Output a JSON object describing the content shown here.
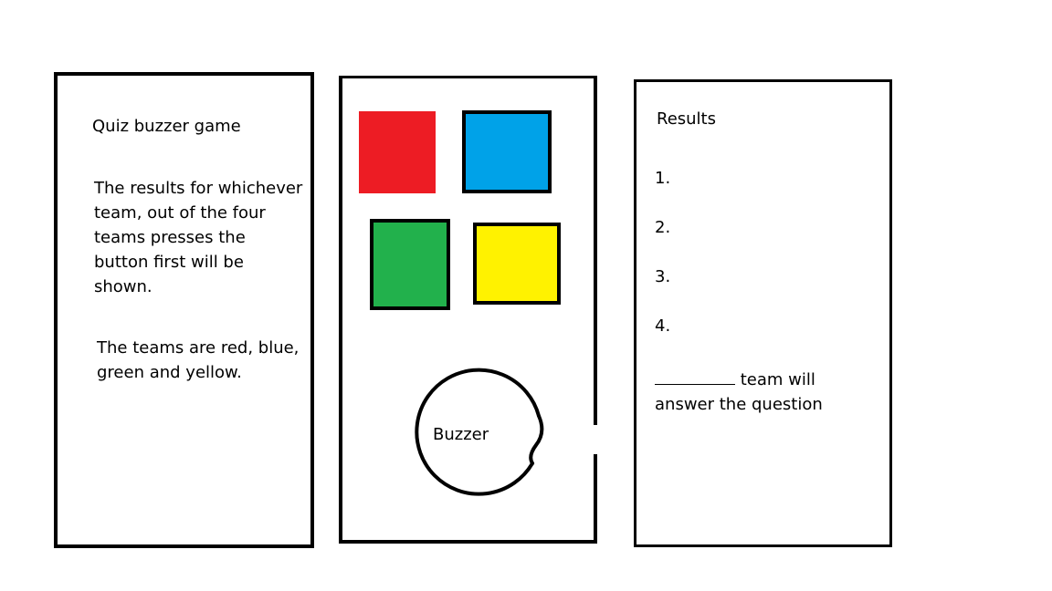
{
  "left_panel": {
    "title": "Quiz buzzer game",
    "description_1": "The results for whichever team, out of the four teams presses the button first will be shown.",
    "description_2": "The teams are red, blue, green and yellow."
  },
  "middle_panel": {
    "buttons": [
      {
        "name": "red",
        "color": "#ED1C24"
      },
      {
        "name": "blue",
        "color": "#00A2E8"
      },
      {
        "name": "green",
        "color": "#22B14C"
      },
      {
        "name": "yellow",
        "color": "#FFF200"
      }
    ],
    "buzzer_label": "Buzzer"
  },
  "right_panel": {
    "title": "Results",
    "ranks": [
      "1.",
      "2.",
      "3.",
      "4."
    ],
    "answer_suffix": "team will answer the question"
  }
}
